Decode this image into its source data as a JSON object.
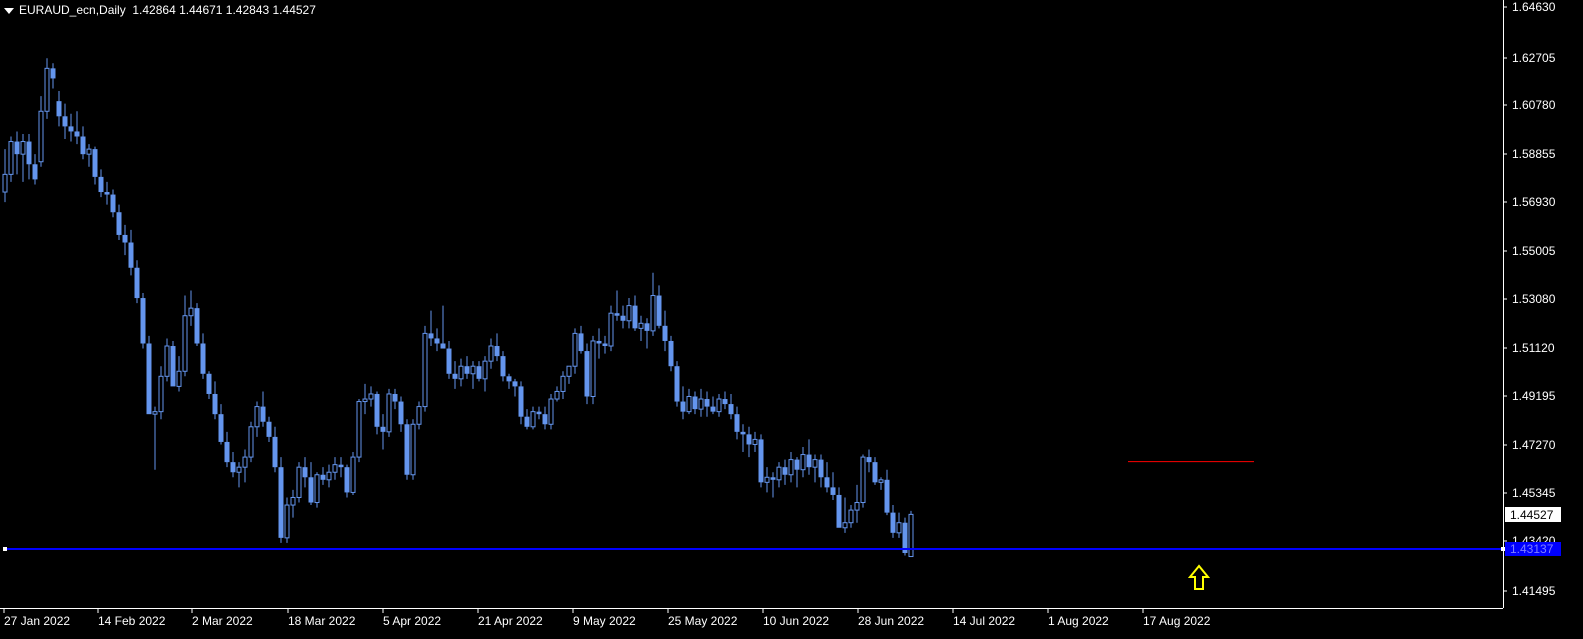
{
  "header": {
    "symbol": "EURAUD_ecn,Daily",
    "ohlc": "1.42864 1.44671 1.42843 1.44527"
  },
  "colors": {
    "background": "#000000",
    "candle": "#6495ED",
    "axis": "#FFFFFF",
    "support_line": "#0000FF",
    "resistance_line": "#FF0000",
    "arrow": "#FFFF00",
    "current_price_bg": "#FFFFFF",
    "support_label_bg": "#0000FF"
  },
  "chart_data": {
    "type": "candlestick",
    "price_axis": {
      "ticks": [
        "1.64630",
        "1.62705",
        "1.60780",
        "1.58855",
        "1.56930",
        "1.55005",
        "1.53080",
        "1.51120",
        "1.49195",
        "1.47270",
        "1.45345",
        "1.43420",
        "1.41495"
      ],
      "range": [
        1.4095,
        1.6475
      ]
    },
    "time_axis": {
      "labels": [
        "27 Jan 2022",
        "14 Feb 2022",
        "2 Mar 2022",
        "18 Mar 2022",
        "5 Apr 2022",
        "21 Apr 2022",
        "9 May 2022",
        "25 May 2022",
        "10 Jun 2022",
        "28 Jun 2022",
        "14 Jul 2022",
        "1 Aug 2022",
        "17 Aug 2022"
      ]
    },
    "current_price": "1.44527",
    "support_price": "1.43137",
    "support_level": 1.4312,
    "resistance_level": 1.4662,
    "candles": [
      [
        1.573,
        1.59,
        1.569,
        1.58
      ],
      [
        1.58,
        1.595,
        1.577,
        1.593
      ],
      [
        1.593,
        1.597,
        1.58,
        1.588
      ],
      [
        1.588,
        1.596,
        1.577,
        1.593
      ],
      [
        1.593,
        1.596,
        1.578,
        1.584
      ],
      [
        1.584,
        1.588,
        1.576,
        1.578
      ],
      [
        1.585,
        1.611,
        1.583,
        1.605
      ],
      [
        1.605,
        1.626,
        1.602,
        1.622
      ],
      [
        1.622,
        1.624,
        1.614,
        1.618
      ],
      [
        1.609,
        1.613,
        1.599,
        1.603
      ],
      [
        1.603,
        1.608,
        1.594,
        1.599
      ],
      [
        1.599,
        1.604,
        1.593,
        1.597
      ],
      [
        1.597,
        1.605,
        1.592,
        1.595
      ],
      [
        1.595,
        1.599,
        1.586,
        1.588
      ],
      [
        1.588,
        1.592,
        1.583,
        1.59
      ],
      [
        1.59,
        1.591,
        1.576,
        1.579
      ],
      [
        1.579,
        1.582,
        1.571,
        1.573
      ],
      [
        1.573,
        1.577,
        1.568,
        1.572
      ],
      [
        1.572,
        1.574,
        1.563,
        1.565
      ],
      [
        1.565,
        1.568,
        1.554,
        1.556
      ],
      [
        1.556,
        1.56,
        1.548,
        1.553
      ],
      [
        1.553,
        1.558,
        1.54,
        1.543
      ],
      [
        1.543,
        1.546,
        1.529,
        1.531
      ],
      [
        1.531,
        1.533,
        1.511,
        1.513
      ],
      [
        1.513,
        1.516,
        1.496,
        1.485
      ],
      [
        1.485,
        1.488,
        1.463,
        1.486
      ],
      [
        1.486,
        1.504,
        1.483,
        1.5
      ],
      [
        1.5,
        1.515,
        1.498,
        1.512
      ],
      [
        1.512,
        1.514,
        1.497,
        1.496
      ],
      [
        1.496,
        1.508,
        1.494,
        1.502
      ],
      [
        1.502,
        1.532,
        1.5,
        1.524
      ],
      [
        1.524,
        1.534,
        1.52,
        1.527
      ],
      [
        1.527,
        1.529,
        1.512,
        1.513
      ],
      [
        1.513,
        1.517,
        1.499,
        1.501
      ],
      [
        1.501,
        1.502,
        1.491,
        1.493
      ],
      [
        1.493,
        1.498,
        1.483,
        1.485
      ],
      [
        1.485,
        1.489,
        1.473,
        1.474
      ],
      [
        1.474,
        1.478,
        1.464,
        1.466
      ],
      [
        1.466,
        1.47,
        1.46,
        1.462
      ],
      [
        1.462,
        1.466,
        1.456,
        1.464
      ],
      [
        1.464,
        1.471,
        1.458,
        1.468
      ],
      [
        1.468,
        1.482,
        1.466,
        1.48
      ],
      [
        1.48,
        1.49,
        1.476,
        1.488
      ],
      [
        1.488,
        1.494,
        1.48,
        1.482
      ],
      [
        1.482,
        1.484,
        1.474,
        1.476
      ],
      [
        1.476,
        1.48,
        1.462,
        1.464
      ],
      [
        1.464,
        1.468,
        1.434,
        1.436
      ],
      [
        1.436,
        1.452,
        1.434,
        1.449
      ],
      [
        1.449,
        1.455,
        1.444,
        1.452
      ],
      [
        1.452,
        1.466,
        1.45,
        1.464
      ],
      [
        1.464,
        1.468,
        1.456,
        1.46
      ],
      [
        1.46,
        1.466,
        1.449,
        1.45
      ],
      [
        1.45,
        1.462,
        1.448,
        1.461
      ],
      [
        1.461,
        1.464,
        1.457,
        1.459
      ],
      [
        1.459,
        1.465,
        1.456,
        1.462
      ],
      [
        1.462,
        1.468,
        1.459,
        1.465
      ],
      [
        1.465,
        1.468,
        1.46,
        1.464
      ],
      [
        1.464,
        1.465,
        1.452,
        1.454
      ],
      [
        1.454,
        1.47,
        1.453,
        1.468
      ],
      [
        1.468,
        1.491,
        1.466,
        1.49
      ],
      [
        1.49,
        1.497,
        1.485,
        1.491
      ],
      [
        1.491,
        1.496,
        1.488,
        1.493
      ],
      [
        1.493,
        1.494,
        1.477,
        1.48
      ],
      [
        1.48,
        1.485,
        1.471,
        1.478
      ],
      [
        1.478,
        1.495,
        1.476,
        1.493
      ],
      [
        1.493,
        1.495,
        1.487,
        1.49
      ],
      [
        1.49,
        1.492,
        1.478,
        1.481
      ],
      [
        1.481,
        1.483,
        1.459,
        1.461
      ],
      [
        1.461,
        1.483,
        1.459,
        1.481
      ],
      [
        1.481,
        1.49,
        1.479,
        1.488
      ],
      [
        1.488,
        1.52,
        1.486,
        1.517
      ],
      [
        1.517,
        1.526,
        1.512,
        1.515
      ],
      [
        1.515,
        1.519,
        1.51,
        1.513
      ],
      [
        1.513,
        1.528,
        1.512,
        1.511
      ],
      [
        1.511,
        1.514,
        1.499,
        1.501
      ],
      [
        1.501,
        1.506,
        1.495,
        1.499
      ],
      [
        1.499,
        1.507,
        1.496,
        1.504
      ],
      [
        1.504,
        1.508,
        1.499,
        1.501
      ],
      [
        1.501,
        1.506,
        1.495,
        1.504
      ],
      [
        1.504,
        1.506,
        1.498,
        1.499
      ],
      [
        1.499,
        1.508,
        1.494,
        1.506
      ],
      [
        1.506,
        1.515,
        1.503,
        1.512
      ],
      [
        1.512,
        1.517,
        1.506,
        1.508
      ],
      [
        1.508,
        1.51,
        1.498,
        1.5
      ],
      [
        1.5,
        1.501,
        1.495,
        1.498
      ],
      [
        1.498,
        1.499,
        1.492,
        1.496
      ],
      [
        1.496,
        1.498,
        1.481,
        1.484
      ],
      [
        1.484,
        1.487,
        1.479,
        1.48
      ],
      [
        1.48,
        1.488,
        1.479,
        1.486
      ],
      [
        1.486,
        1.488,
        1.483,
        1.485
      ],
      [
        1.485,
        1.488,
        1.479,
        1.481
      ],
      [
        1.481,
        1.493,
        1.479,
        1.491
      ],
      [
        1.491,
        1.496,
        1.49,
        1.494
      ],
      [
        1.494,
        1.502,
        1.491,
        1.5
      ],
      [
        1.5,
        1.502,
        1.497,
        1.504
      ],
      [
        1.504,
        1.519,
        1.501,
        1.517
      ],
      [
        1.517,
        1.52,
        1.509,
        1.51
      ],
      [
        1.51,
        1.513,
        1.489,
        1.492
      ],
      [
        1.492,
        1.516,
        1.489,
        1.514
      ],
      [
        1.514,
        1.519,
        1.507,
        1.513
      ],
      [
        1.513,
        1.516,
        1.509,
        1.512
      ],
      [
        1.512,
        1.528,
        1.51,
        1.525
      ],
      [
        1.525,
        1.534,
        1.522,
        1.524
      ],
      [
        1.524,
        1.528,
        1.519,
        1.522
      ],
      [
        1.522,
        1.531,
        1.519,
        1.528
      ],
      [
        1.528,
        1.532,
        1.518,
        1.519
      ],
      [
        1.519,
        1.524,
        1.514,
        1.521
      ],
      [
        1.521,
        1.523,
        1.511,
        1.518
      ],
      [
        1.518,
        1.541,
        1.516,
        1.532
      ],
      [
        1.532,
        1.536,
        1.519,
        1.52
      ],
      [
        1.52,
        1.526,
        1.51,
        1.514
      ],
      [
        1.514,
        1.516,
        1.502,
        1.504
      ],
      [
        1.504,
        1.506,
        1.488,
        1.49
      ],
      [
        1.49,
        1.496,
        1.483,
        1.486
      ],
      [
        1.486,
        1.495,
        1.485,
        1.492
      ],
      [
        1.492,
        1.494,
        1.485,
        1.487
      ],
      [
        1.487,
        1.495,
        1.484,
        1.491
      ],
      [
        1.491,
        1.494,
        1.484,
        1.488
      ],
      [
        1.488,
        1.492,
        1.485,
        1.486
      ],
      [
        1.486,
        1.493,
        1.484,
        1.491
      ],
      [
        1.491,
        1.494,
        1.487,
        1.489
      ],
      [
        1.489,
        1.493,
        1.483,
        1.485
      ],
      [
        1.485,
        1.488,
        1.475,
        1.478
      ],
      [
        1.478,
        1.481,
        1.47,
        1.477
      ],
      [
        1.477,
        1.48,
        1.468,
        1.473
      ],
      [
        1.473,
        1.478,
        1.47,
        1.475
      ],
      [
        1.475,
        1.477,
        1.456,
        1.458
      ],
      [
        1.458,
        1.464,
        1.454,
        1.46
      ],
      [
        1.46,
        1.462,
        1.452,
        1.459
      ],
      [
        1.459,
        1.466,
        1.456,
        1.464
      ],
      [
        1.464,
        1.467,
        1.457,
        1.461
      ],
      [
        1.461,
        1.47,
        1.458,
        1.467
      ],
      [
        1.467,
        1.468,
        1.456,
        1.463
      ],
      [
        1.463,
        1.472,
        1.46,
        1.469
      ],
      [
        1.469,
        1.475,
        1.461,
        1.464
      ],
      [
        1.464,
        1.469,
        1.458,
        1.467
      ],
      [
        1.467,
        1.469,
        1.456,
        1.46
      ],
      [
        1.46,
        1.466,
        1.454,
        1.456
      ],
      [
        1.456,
        1.462,
        1.451,
        1.453
      ],
      [
        1.453,
        1.456,
        1.445,
        1.44
      ],
      [
        1.44,
        1.452,
        1.438,
        1.442
      ],
      [
        1.442,
        1.449,
        1.44,
        1.447
      ],
      [
        1.447,
        1.457,
        1.442,
        1.45
      ],
      [
        1.45,
        1.469,
        1.448,
        1.468
      ],
      [
        1.468,
        1.471,
        1.462,
        1.466
      ],
      [
        1.466,
        1.468,
        1.457,
        1.458
      ],
      [
        1.458,
        1.46,
        1.455,
        1.459
      ],
      [
        1.459,
        1.463,
        1.445,
        1.446
      ],
      [
        1.446,
        1.449,
        1.436,
        1.438
      ],
      [
        1.438,
        1.446,
        1.436,
        1.442
      ],
      [
        1.442,
        1.444,
        1.429,
        1.43
      ],
      [
        1.4286,
        1.4467,
        1.4284,
        1.4453
      ]
    ]
  }
}
